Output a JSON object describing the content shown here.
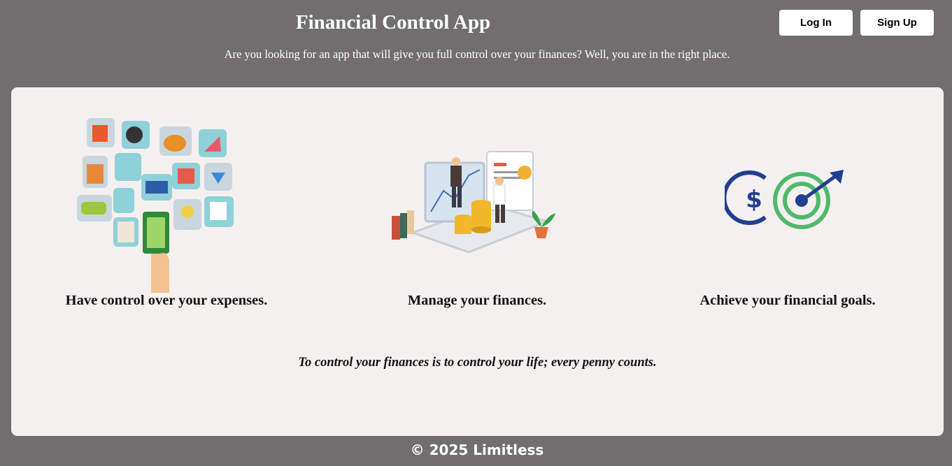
{
  "header": {
    "title": "Financial Control App",
    "subtitle": "Are you looking for an app that will give you full control over your finances? Well, you are in the right place.",
    "login_label": "Log In",
    "signup_label": "Sign Up"
  },
  "features": [
    {
      "caption": "Have control over your expenses.",
      "icon": "expenses-illustration"
    },
    {
      "caption": "Manage your finances.",
      "icon": "finance-management-illustration"
    },
    {
      "caption": "Achieve your financial goals.",
      "icon": "goal-target-icon"
    }
  ],
  "quote": "To control your finances is to control your life; every penny counts.",
  "footer": "© 2025 Limitless",
  "colors": {
    "background": "#706e6f",
    "panel": "#f4f0ef",
    "button": "#ffffff",
    "goal_blue": "#213f8f",
    "goal_green": "#4fb96a"
  }
}
